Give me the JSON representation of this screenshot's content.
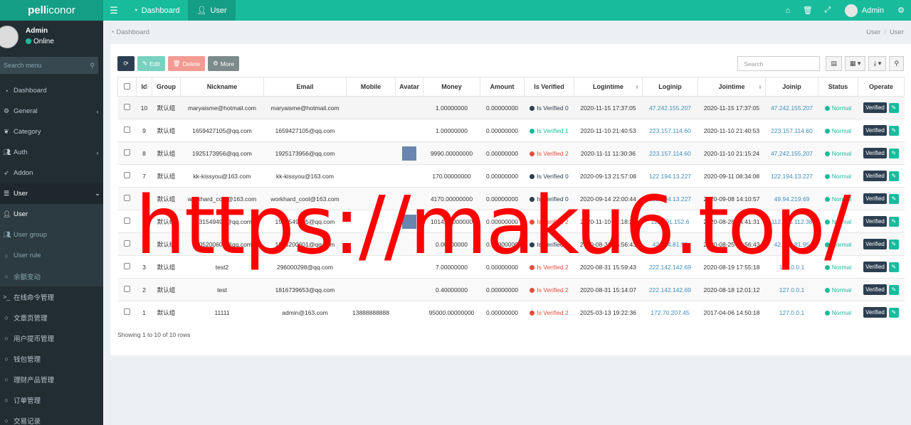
{
  "app": {
    "logo_bold": "pell",
    "logo_rest": "iconor"
  },
  "topnav": [
    {
      "label": "Dashboard",
      "icon": "dashboard-icon"
    },
    {
      "label": "User",
      "icon": "user-icon"
    }
  ],
  "header_user": {
    "name": "Admin"
  },
  "sidebar_user": {
    "name": "Admin",
    "status": "Online"
  },
  "sidebar_search": {
    "placeholder": "Search menu"
  },
  "menu": [
    {
      "label": "Dashboard",
      "icon": "dashboard-icon",
      "arrow": ""
    },
    {
      "label": "General",
      "icon": "cogs-icon",
      "arrow": "‹"
    },
    {
      "label": "Category",
      "icon": "leaf-icon",
      "arrow": ""
    },
    {
      "label": "Auth",
      "icon": "group-icon",
      "arrow": "‹"
    },
    {
      "label": "Addon",
      "icon": "rocket-icon",
      "arrow": ""
    },
    {
      "label": "User",
      "icon": "list-icon",
      "arrow": "⌄"
    },
    {
      "label": "User",
      "icon": "user-icon",
      "arrow": ""
    },
    {
      "label": "User group",
      "icon": "users-icon",
      "arrow": ""
    },
    {
      "label": "User rule",
      "icon": "circle-icon",
      "arrow": ""
    },
    {
      "label": "余额变动",
      "icon": "circle-icon",
      "arrow": ""
    },
    {
      "label": "在线命令管理",
      "icon": "terminal-icon",
      "arrow": ""
    },
    {
      "label": "文章页管理",
      "icon": "circle-icon",
      "arrow": ""
    },
    {
      "label": "用户提币管理",
      "icon": "circle-icon",
      "arrow": ""
    },
    {
      "label": "钱包管理",
      "icon": "circle-icon",
      "arrow": ""
    },
    {
      "label": "理财产品管理",
      "icon": "circle-icon",
      "arrow": ""
    },
    {
      "label": "订单管理",
      "icon": "circle-icon",
      "arrow": ""
    },
    {
      "label": "交易记录",
      "icon": "circle-icon",
      "arrow": ""
    }
  ],
  "breadcrumb": {
    "left": "Dashboard",
    "right1": "User",
    "sep": "/",
    "right2": "User"
  },
  "toolbar": {
    "edit": "Edit",
    "delete": "Delete",
    "more": "More"
  },
  "table_search": {
    "placeholder": "Search"
  },
  "columns": [
    "",
    "Id",
    "Group",
    "Nickname",
    "Email",
    "Mobile",
    "Avatar",
    "Money",
    "Amount",
    "Is Verified",
    "Logintime",
    "Loginip",
    "Jointime",
    "Joinip",
    "Status",
    "Operate"
  ],
  "rows": [
    {
      "id": "10",
      "group": "默认组",
      "nickname": "maryaisme@hotmail.com",
      "email": "maryaisme@hotmail.com",
      "mobile": "",
      "avatar": false,
      "money": "1.00000000",
      "amount": "0.00000000",
      "verified": "Is Verified 0",
      "vcolor": "dark",
      "logintime": "2020-11-15 17:37:05",
      "loginip": "47.242.155.207",
      "jointime": "2020-11-15 17:37:05",
      "joinip": "47.242.155.207",
      "status": "Normal",
      "op": "Verified"
    },
    {
      "id": "9",
      "group": "默认组",
      "nickname": "1659427105@qq.com",
      "email": "1659427105@qq.com",
      "mobile": "",
      "avatar": false,
      "money": "1.00000000",
      "amount": "0.00000000",
      "verified": "Is Verified 1",
      "vcolor": "green",
      "logintime": "2020-11-10 21:40:53",
      "loginip": "223.157.114.60",
      "jointime": "2020-11-10 21:40:53",
      "joinip": "223.157.114.60",
      "status": "Normal",
      "op": "Verified"
    },
    {
      "id": "8",
      "group": "默认组",
      "nickname": "1925173956@qq.com",
      "email": "1925173956@qq.com",
      "mobile": "",
      "avatar": true,
      "money": "9990.00000000",
      "amount": "0.00000000",
      "verified": "Is Verified 2",
      "vcolor": "red",
      "logintime": "2020-11-11 11:30:36",
      "loginip": "223.157.114.60",
      "jointime": "2020-11-10 21:15:24",
      "joinip": "47.242.155.207",
      "status": "Normal",
      "op": "Verified"
    },
    {
      "id": "7",
      "group": "默认组",
      "nickname": "kk-kissyou@163.com",
      "email": "kk-kissyou@163.com",
      "mobile": "",
      "avatar": false,
      "money": "170.00000000",
      "amount": "0.00000000",
      "verified": "Is Verified 0",
      "vcolor": "dark",
      "logintime": "2020-09-13 21:57:08",
      "loginip": "122.194.13.227",
      "jointime": "2020-09-11 08:34:08",
      "joinip": "122.194.13.227",
      "status": "Normal",
      "op": "Verified"
    },
    {
      "id": "6",
      "group": "默认组",
      "nickname": "workhard_cool@163.com",
      "email": "workhard_cool@163.com",
      "mobile": "",
      "avatar": false,
      "money": "4170.00000000",
      "amount": "0.00000000",
      "verified": "Is Verified 0",
      "vcolor": "dark",
      "logintime": "2020-09-14 22:00:44",
      "loginip": "122.194.13.227",
      "jointime": "2020-09-08 14:10:57",
      "joinip": "49.94.219.69",
      "status": "Normal",
      "op": "Verified"
    },
    {
      "id": "",
      "group": "默认组",
      "nickname": "1531549495@qq.com",
      "email": "1531549495@qq.com",
      "mobile": "",
      "avatar": true,
      "money": "1014.00000000",
      "amount": "0.00000000",
      "verified": "Is Verified 2",
      "vcolor": "red",
      "logintime": "2020-11-10 21:18:34",
      "loginip": "112.191.152.6",
      "jointime": "2020-08-28 14:41:31",
      "joinip": "112.195.112.38",
      "status": "Normal",
      "op": "Verified"
    },
    {
      "id": "",
      "group": "默认组",
      "nickname": "1905200601@qq.com",
      "email": "1905200601@qq.com",
      "mobile": "",
      "avatar": false,
      "money": "0.00000000",
      "amount": "0.00000000",
      "verified": "Is Verified 0",
      "vcolor": "dark",
      "logintime": "2020-08-31 15:56:43",
      "loginip": "42.234.81.95",
      "jointime": "2020-08-25 15:56:43",
      "joinip": "42.234.81.95",
      "status": "Normal",
      "op": "Verified"
    },
    {
      "id": "3",
      "group": "默认组",
      "nickname": "test2",
      "email": "296000298@qq.com",
      "mobile": "",
      "avatar": false,
      "money": "7.00000000",
      "amount": "0.00000000",
      "verified": "Is Verified 2",
      "vcolor": "red",
      "logintime": "2020-08-31 15:59:43",
      "loginip": "222.142.142.69",
      "jointime": "2020-08-19 17:55:18",
      "joinip": "127.0.0.1",
      "status": "Normal",
      "op": "Verified"
    },
    {
      "id": "2",
      "group": "默认组",
      "nickname": "test",
      "email": "1816739653@qq.com",
      "mobile": "",
      "avatar": false,
      "money": "0.40000000",
      "amount": "0.00000000",
      "verified": "Is Verified 2",
      "vcolor": "red",
      "logintime": "2020-08-31 15:14:07",
      "loginip": "222.142.142.69",
      "jointime": "2020-08-18 12:01:12",
      "joinip": "127.0.0.1",
      "status": "Normal",
      "op": "Verified"
    },
    {
      "id": "1",
      "group": "默认组",
      "nickname": "11111",
      "email": "admin@163.com",
      "mobile": "13888888888",
      "avatar": false,
      "money": "95000.00000000",
      "amount": "0.00000000",
      "verified": "Is Verified 2",
      "vcolor": "red",
      "logintime": "2025-03-13 19:22:36",
      "loginip": "172.70.207.45",
      "jointime": "2017-04-06 14:50:18",
      "joinip": "127.0.0.1",
      "status": "Normal",
      "op": "Verified"
    }
  ],
  "footer": {
    "showing": "Showing 1 to 10 of 10 rows"
  },
  "watermark": {
    "text": "https://maku6.top/"
  },
  "colors": {
    "brand": "#18bc9c",
    "brand_dark": "#149e85",
    "sidebar": "#222d32",
    "danger": "#e74c3c",
    "dark": "#2c3e50",
    "link": "#3c8dbc"
  }
}
